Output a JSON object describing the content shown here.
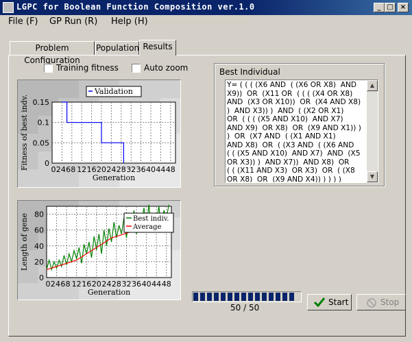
{
  "window": {
    "title": "LGPC for Boolean Function Composition ver.1.0",
    "buttons": {
      "minimize": "_",
      "maximize": "□",
      "close": "×"
    }
  },
  "menu": [
    {
      "label": "File (F)"
    },
    {
      "label": "GP Run (R)"
    },
    {
      "label": "Help (H)"
    }
  ],
  "tabs": [
    {
      "label": "Problem Configuration"
    },
    {
      "label": "Population"
    },
    {
      "label": "Results",
      "selected": true
    }
  ],
  "options": {
    "training_fitness": {
      "label": "Training fitness",
      "checked": false
    },
    "auto_zoom": {
      "label": "Auto zoom",
      "checked": false
    }
  },
  "best_individual": {
    "label": "Best Individual",
    "lines": [
      "Y= ( ( ( (X6 AND  ( (X6 OR X8)  AND",
      "X9))  OR  (X11 OR  ( ( ( (X4 OR X8)",
      "AND  (X3 OR X10))  OR  (X4 AND X8)",
      ")  AND X3)) )  AND  ( (X2 OR X1)",
      "OR  ( ( ( (X5 AND X10)  AND X7)",
      "AND X9)  OR X8)  OR  (X9 AND X1)) )",
      ")  OR  (X7 AND  ( (X1 AND X1)",
      "AND X8)  OR  ( (X3 AND  ( (X6 AND",
      "( ( (X5 AND X10)  AND X7)  AND  (X5",
      "OR X3)) )  AND X7))  AND X8)  OR",
      "( ( (X11 AND X3)  OR X3)  OR  ( (X8",
      "OR X8)  OR  (X9 AND X4)) ) ) ) )"
    ]
  },
  "progress": {
    "text": "50 / 50",
    "fraction": 1.0
  },
  "buttons": {
    "start": "Start",
    "stop": "Stop"
  },
  "chart_data": [
    {
      "type": "line",
      "ylabel": "Fitness of best indv.",
      "xlabel": "Generation",
      "xlim": [
        0,
        50
      ],
      "ylim": [
        0,
        0.15
      ],
      "x_ticks": [
        "0",
        "2",
        "4",
        "6",
        "8",
        "12",
        "16",
        "20",
        "24",
        "28",
        "32",
        "36",
        "40",
        "44",
        "48"
      ],
      "y_ticks": [
        "0",
        "0.05",
        "0.1",
        "0.15"
      ],
      "legend": "top-right",
      "series": [
        {
          "name": "Validation",
          "color": "#0000ff",
          "points": [
            [
              4,
              0.15
            ],
            [
              6,
              0.1
            ],
            [
              18,
              0.1
            ],
            [
              20,
              0.05
            ],
            [
              28,
              0.05
            ],
            [
              29,
              0
            ]
          ]
        }
      ]
    },
    {
      "type": "line",
      "ylabel": "Length of gene",
      "xlabel": "Generation",
      "xlim": [
        0,
        50
      ],
      "ylim": [
        0,
        90
      ],
      "x_ticks": [
        "0",
        "2",
        "4",
        "6",
        "8",
        "12",
        "16",
        "20",
        "24",
        "28",
        "32",
        "36",
        "40",
        "44",
        "48"
      ],
      "y_ticks": [
        "0",
        "20",
        "40",
        "60",
        "80"
      ],
      "legend": "top-right",
      "series": [
        {
          "name": "Best indiv.",
          "color": "#008000",
          "values": [
            10,
            22,
            10,
            20,
            12,
            22,
            14,
            28,
            16,
            30,
            20,
            34,
            24,
            38,
            18,
            42,
            30,
            45,
            25,
            52,
            35,
            55,
            30,
            60,
            40,
            62,
            45,
            70,
            50,
            66,
            55,
            75,
            50,
            80,
            60,
            85,
            55,
            78,
            70,
            88,
            65,
            92,
            60,
            80,
            70,
            90,
            60,
            85,
            75,
            92
          ]
        },
        {
          "name": "Average",
          "color": "#ff0000",
          "values": [
            10,
            11,
            12,
            13,
            14,
            15,
            16,
            17,
            18,
            19,
            20,
            21,
            22,
            24,
            26,
            28,
            30,
            32,
            34,
            36,
            38,
            40,
            42,
            44,
            46,
            48,
            50,
            51,
            52,
            53,
            54,
            55,
            56,
            57,
            58,
            59,
            60,
            60,
            61,
            61,
            62,
            62,
            62,
            63,
            63,
            63,
            63,
            64,
            64,
            64
          ]
        }
      ]
    }
  ]
}
